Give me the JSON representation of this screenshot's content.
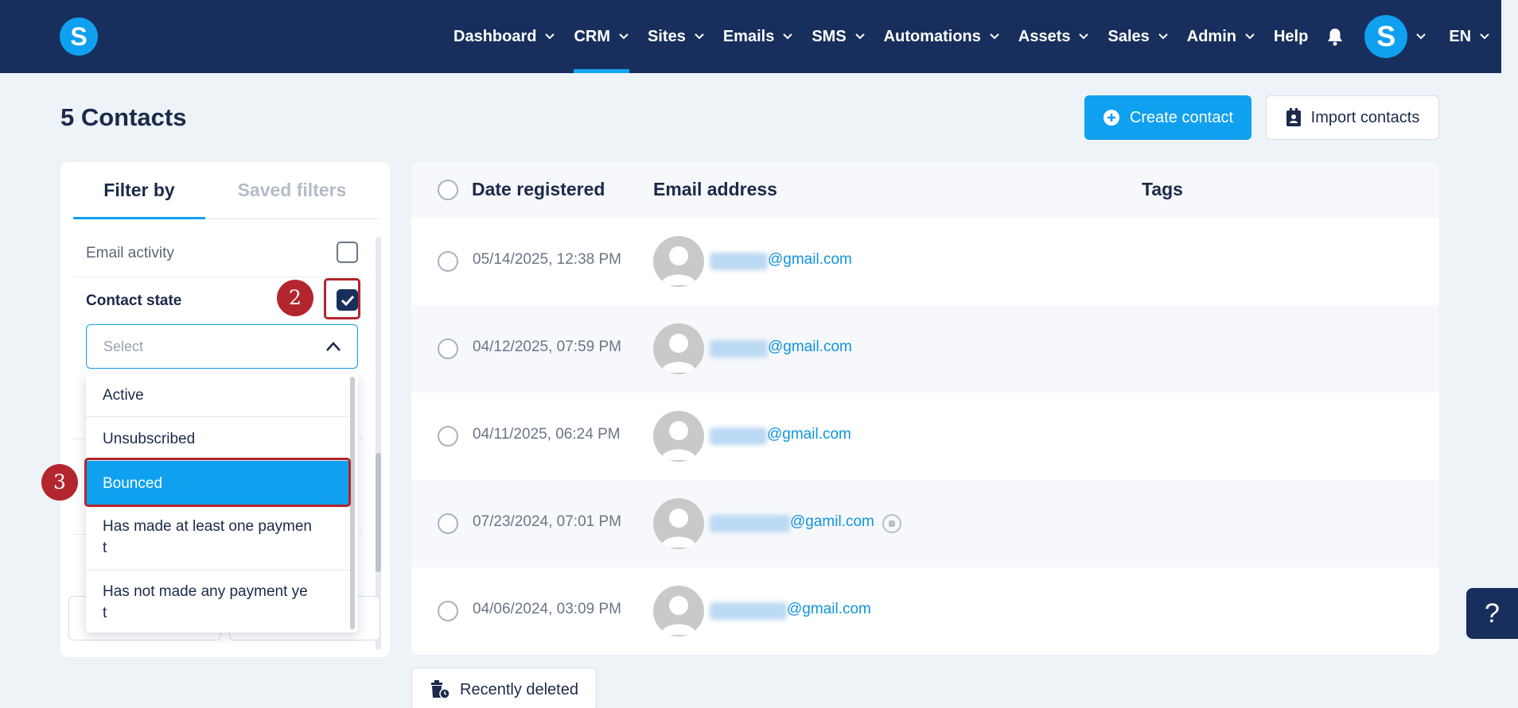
{
  "nav": {
    "logo": "S",
    "items": [
      {
        "label": "Dashboard",
        "dropdown": true
      },
      {
        "label": "CRM",
        "dropdown": true,
        "active": true
      },
      {
        "label": "Sites",
        "dropdown": true
      },
      {
        "label": "Emails",
        "dropdown": true
      },
      {
        "label": "SMS",
        "dropdown": true
      },
      {
        "label": "Automations",
        "dropdown": true
      },
      {
        "label": "Assets",
        "dropdown": true
      },
      {
        "label": "Sales",
        "dropdown": true
      },
      {
        "label": "Admin",
        "dropdown": true
      },
      {
        "label": "Help",
        "dropdown": false
      }
    ],
    "avatar_letter": "S",
    "language": "EN"
  },
  "page": {
    "title": "5 Contacts",
    "create_label": "Create contact",
    "import_label": "Import contacts",
    "recently_deleted_label": "Recently deleted"
  },
  "filter": {
    "tab_filter": "Filter by",
    "tab_saved": "Saved filters",
    "email_activity": "Email activity",
    "contact_state": "Contact state",
    "select_placeholder": "Select",
    "options": [
      {
        "line1": "Active",
        "line2": ""
      },
      {
        "line1": "Unsubscribed",
        "line2": ""
      },
      {
        "line1": "Bounced",
        "line2": "",
        "selected": true
      },
      {
        "line1": "Has made at least one paymen",
        "line2": "t"
      },
      {
        "line1": "Has not made any payment ye",
        "line2": "t"
      }
    ]
  },
  "annotations": {
    "step2": "2",
    "step3": "3"
  },
  "table": {
    "headers": {
      "date": "Date registered",
      "email": "Email address",
      "tags": "Tags"
    },
    "rows": [
      {
        "date": "05/14/2025, 12:38 PM",
        "email_domain": "@gmail.com"
      },
      {
        "date": "04/12/2025, 07:59 PM",
        "email_domain": "@gmail.com"
      },
      {
        "date": "04/11/2025, 06:24 PM",
        "email_domain": "@gmail.com"
      },
      {
        "date": "07/23/2024, 07:01 PM",
        "email_domain": "@gamil.com"
      },
      {
        "date": "04/06/2024, 03:09 PM",
        "email_domain": "@gmail.com"
      }
    ]
  },
  "help_button": "?",
  "colors": {
    "nav_bg": "#182f5d",
    "accent": "#0fa0ef",
    "annotation": "#b3262e",
    "page_bg": "#eef3f8"
  }
}
